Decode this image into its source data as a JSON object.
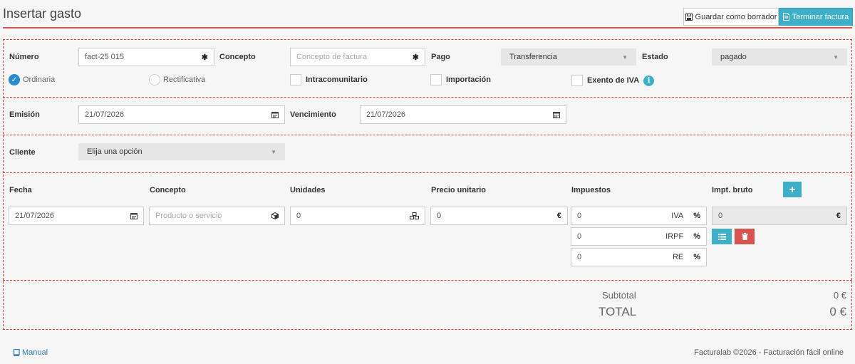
{
  "header": {
    "title": "Insertar gasto",
    "draft_label": "Guardar como borrador",
    "finish_label": "Terminar factura"
  },
  "invoice": {
    "numero_label": "Número",
    "numero_value": "fact-25 015",
    "concepto_label": "Concepto",
    "concepto_placeholder": "Concepto de factura",
    "pago_label": "Pago",
    "pago_value": "Transferencia",
    "estado_label": "Estado",
    "estado_value": "pagado",
    "ordinaria_label": "Ordinaria",
    "rectificativa_label": "Rectificativa",
    "intracomunitario_label": "Intracomunitario",
    "importacion_label": "Importación",
    "exento_label": "Exento de IVA"
  },
  "dates": {
    "emision_label": "Emisión",
    "emision_value": "21/07/2026",
    "vencimiento_label": "Vencimiento",
    "vencimiento_value": "21/07/2026"
  },
  "client": {
    "label": "Cliente",
    "value": "Elija una opción"
  },
  "lines": {
    "headers": {
      "fecha": "Fecha",
      "concepto": "Concepto",
      "unidades": "Unidades",
      "precio": "Precio unitario",
      "impuestos": "Impuestos",
      "bruto": "Impt. bruto"
    },
    "row": {
      "fecha": "21/07/2026",
      "concepto_placeholder": "Producto o servicio",
      "unidades": "0",
      "precio": "0",
      "precio_suffix": "€",
      "iva_value": "0",
      "iva_label": "IVA",
      "irpf_value": "0",
      "irpf_label": "IRPF",
      "re_value": "0",
      "re_label": "RE",
      "percent": "%",
      "bruto_value": "0",
      "bruto_suffix": "€"
    }
  },
  "totals": {
    "subtotal_label": "Subtotal",
    "subtotal_value": "0 €",
    "total_label": "TOTAL",
    "total_value": "0 €"
  },
  "footer": {
    "manual_label": "Manual",
    "copyright": "Facturalab ©2026 - Facturación fácil online"
  },
  "colors": {
    "accent": "#3cb0c9",
    "danger": "#d9534f",
    "radio_checked": "#2a8bd2"
  }
}
